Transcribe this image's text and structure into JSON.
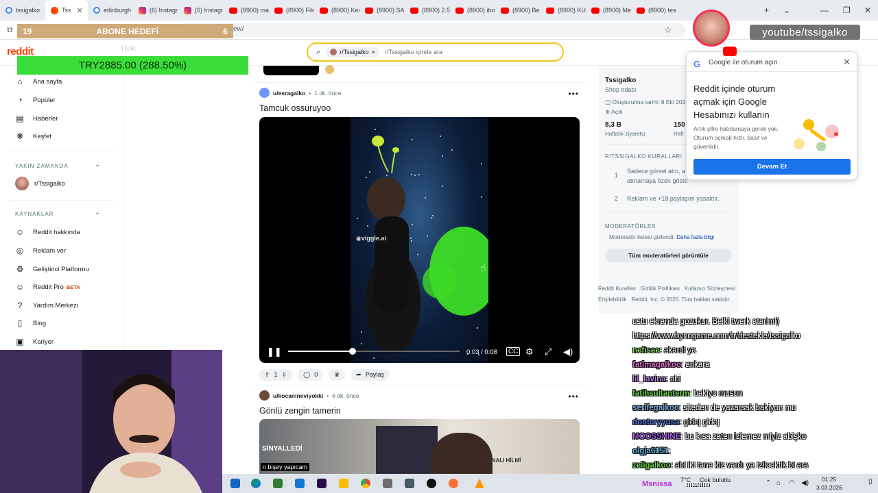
{
  "browser": {
    "tabs": [
      {
        "label": "tssigalko",
        "icon": "google-icon"
      },
      {
        "label": "Tss",
        "icon": "reddit-icon",
        "active": true
      },
      {
        "label": "edinburgh",
        "icon": "google-icon"
      },
      {
        "label": "(6) Instagr",
        "icon": "instagram-icon"
      },
      {
        "label": "(6) Instagr",
        "icon": "instagram-icon"
      },
      {
        "label": "(8900) ma",
        "icon": "youtube-icon"
      },
      {
        "label": "(8900) Filo",
        "icon": "youtube-icon"
      },
      {
        "label": "(8900) Ker",
        "icon": "youtube-icon"
      },
      {
        "label": "(8900) SAF",
        "icon": "youtube-icon"
      },
      {
        "label": "(8900) 2.5",
        "icon": "youtube-icon"
      },
      {
        "label": "(8900) ibo",
        "icon": "youtube-icon"
      },
      {
        "label": "(8900) Be",
        "icon": "youtube-icon"
      },
      {
        "label": "(8900) KU",
        "icon": "youtube-icon"
      },
      {
        "label": "(8900) Me",
        "icon": "youtube-icon"
      },
      {
        "label": "(8900) tes",
        "icon": "youtube-icon"
      }
    ],
    "new_tab": "+",
    "url_fragment": "ew/"
  },
  "stream_overlay": {
    "abone_count": "19",
    "abone_label": "ABONE HEDEFİ",
    "abone_goal": "6",
    "donation": "TRY2885.00 (288.50%)",
    "faded_label": "TİVİK",
    "youtube_handle": "youtube/tssigalko"
  },
  "reddit": {
    "logo": "reddit",
    "search_chip": "r/Tssigalko",
    "search_placeholder": "r/Tssigalko içinde ara",
    "sidebar": {
      "items": [
        {
          "label": "Ana sayfa",
          "icon": "home-icon"
        },
        {
          "label": "Popüler",
          "icon": "popular-icon"
        },
        {
          "label": "Haberler",
          "icon": "news-icon"
        },
        {
          "label": "Keşfet",
          "icon": "explore-icon"
        }
      ],
      "recent_title": "YAKIN ZAMANDA",
      "recent_items": [
        {
          "label": "r/Tssigalko"
        }
      ],
      "resources_title": "KAYNAKLAR",
      "resources": [
        {
          "label": "Reddit hakkında",
          "icon": "reddit-icon"
        },
        {
          "label": "Reklam ver",
          "icon": "advertise-icon"
        },
        {
          "label": "Geliştirici Platformu",
          "icon": "developer-icon"
        },
        {
          "label": "Reddit Pro",
          "icon": "pro-icon",
          "badge": "BETA"
        },
        {
          "label": "Yardım Merkezi",
          "icon": "help-icon"
        },
        {
          "label": "Blog",
          "icon": "blog-icon"
        },
        {
          "label": "Kariyer",
          "icon": "career-icon"
        }
      ]
    },
    "posts": [
      {
        "author": "u/esragalko",
        "time": "1 dk. önce",
        "title": "Tamcuk ossuruyoo",
        "video": {
          "time_current": "0:03",
          "time_separator": " / ",
          "time_total": "0:08",
          "progress": 0.375,
          "watermark": "viggle.ai"
        },
        "votes": "1",
        "comments": "0",
        "share_label": "Paylaş"
      },
      {
        "author": "u/kocanineviyokki",
        "time": "6 dk. önce",
        "title": "Gönlü zengin tamerin",
        "thumb_text_1": "SİNYALLEDİ",
        "thumb_text_2": "n bişey yapıcam",
        "thumb_text_3": "TUNALI HİLMİ"
      }
    ],
    "community": {
      "name": "Tssigalko",
      "subtitle": "Shop odası",
      "created": "Oluşturulma tarihi: 8 Eki 2024",
      "visibility": "Açık",
      "stat1_value": "8,3 B",
      "stat1_label": "Haftalık ziyaretçi",
      "stat2_value": "150",
      "stat2_label": "Haft",
      "rules_title": "R/TSSIGALKO KURALLARI",
      "rules": [
        {
          "num": "1",
          "text": "Sadece görsel atın, a",
          "text2": "atmamaya özen göste"
        },
        {
          "num": "2",
          "text": "Reklam ve +18 paylaşım yasaktır."
        }
      ],
      "mods_title": "MODERATÖRLER",
      "mods_hidden": "Moderatör listesi gizlendi.",
      "mods_more": "Daha fazla bilgi",
      "mods_button": "Tüm moderatörleri görüntüle",
      "footer_links": [
        "Reddit Kuralları",
        "Gizlilik Politikası",
        "Kullanıcı Sözleşmesi"
      ],
      "footer_line2": "Erişilebilirlik   Reddit, Inc. © 2026. Tüm hakları saklıdır."
    }
  },
  "google_popup": {
    "title": "Google ile oturum açın",
    "heading": "Reddit içinde oturum açmak için Google Hesabınızı kullanın",
    "body": "Artık şifre hatırlamaya gerek yok. Oturum açmak hızlı, basit ve güvenlidir.",
    "button": "Devam Et"
  },
  "chat": [
    {
      "user": "",
      "text": "ustu ekranda gozukur. Belki twerk atarim!)",
      "color": "#ffffff"
    },
    {
      "user": "",
      "text": "https://www.bynogame.com/tr/destekle/tssigalko",
      "color": "#ffffff"
    },
    {
      "user": "nefisee",
      "text": ": akardi ya",
      "color": "#8ee36a"
    },
    {
      "user": "fatimagalkoo",
      "text": ": ankara",
      "color": "#d36ac2"
    },
    {
      "user": "lil_lavina",
      "text": ": abi",
      "color": "#b58ae0"
    },
    {
      "user": "fatihsultanterm",
      "text": ": bakiyo musun",
      "color": "#6ad04a"
    },
    {
      "user": "serifegalkoo",
      "text": ": siteden de yazarsak bakiyon mu",
      "color": "#7fa8d8"
    },
    {
      "user": "dontcryyusa",
      "text": ": gldej gldej",
      "color": "#5b7fe0"
    },
    {
      "user": "MOOSSHINE",
      "text": ": bu kısa zaten izlemez miyiz abişko",
      "color": "#a061e0"
    },
    {
      "user": "olgja6151",
      "text": ":",
      "color": "#5bb5e0"
    },
    {
      "user": "zeligalkoo",
      "text": ": abi iki tane kiz vardı ya izlicektik bi ara",
      "color": "#6ad04a"
    }
  ],
  "taskbar": {
    "weather_label": "Msnissa",
    "search_hint": "Çok bulutlu",
    "temp": "7°C",
    "chat_overlay_name": "mamm",
    "clock_time": "01:25",
    "clock_date": "3.03.2026"
  },
  "colors": {
    "reddit_orange": "#ff4500",
    "google_blue": "#1a73e8",
    "donate_green": "#3adc3a",
    "abone_tan": "#cdaa78",
    "search_border": "#f5c518"
  }
}
